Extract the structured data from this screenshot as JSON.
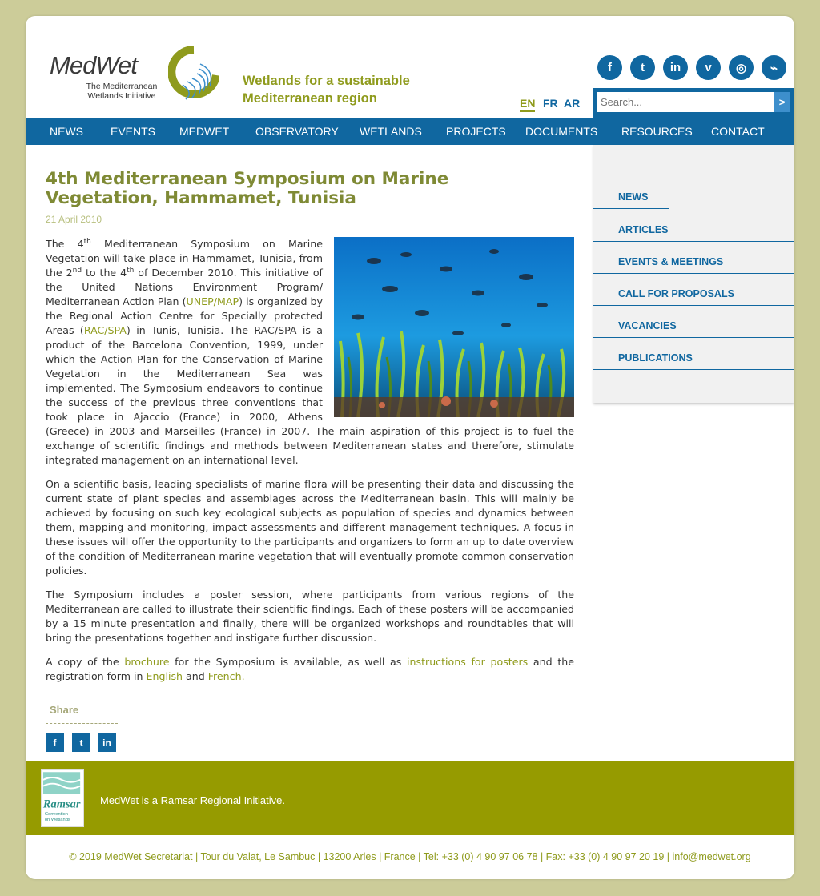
{
  "header": {
    "logo_word": "MedWet",
    "logo_sub": "The Mediterranean Wetlands Initiative",
    "tagline_line1": "Wetlands for a sustainable",
    "tagline_line2": "Mediterranean region",
    "social": [
      {
        "name": "facebook-icon",
        "glyph": "f"
      },
      {
        "name": "twitter-icon",
        "glyph": "t"
      },
      {
        "name": "linkedin-icon",
        "glyph": "in"
      },
      {
        "name": "vimeo-icon",
        "glyph": "v"
      },
      {
        "name": "instagram-icon",
        "glyph": "◎"
      },
      {
        "name": "rss-icon",
        "glyph": "⌁"
      }
    ],
    "languages": [
      "EN",
      "FR",
      "AR"
    ],
    "search_placeholder": "Search...",
    "search_button": ">"
  },
  "nav": [
    "NEWS",
    "EVENTS",
    "MEDWET",
    "OBSERVATORY",
    "WETLANDS",
    "PROJECTS",
    "DOCUMENTS",
    "RESOURCES",
    "CONTACT"
  ],
  "sidebar": [
    "NEWS",
    "ARTICLES",
    "EVENTS & MEETINGS",
    "CALL FOR PROPOSALS",
    "VACANCIES",
    "PUBLICATIONS"
  ],
  "article": {
    "title": "4th Mediterranean Symposium on Marine Vegetation, Hammamet, Tunisia",
    "date": "21 April 2010",
    "p1_a": "The 4",
    "p1_sup1": "th",
    "p1_b": " Mediterranean Symposium on Marine Vegetation will take place in Hammamet, Tunisia, from the 2",
    "p1_sup2": "nd",
    "p1_c": " to the 4",
    "p1_sup3": "th",
    "p1_d": " of December 2010. This initiative of the United Nations Environment Program/ Mediterranean Action Plan (",
    "p1_link1": "UNEP/MAP",
    "p1_e": ") is organized by the Regional Action Centre for Specially protected Areas (",
    "p1_link2": "RAC/SPA",
    "p1_f": ") in Tunis, Tunisia. The RAC/SPA is a product of the Barcelona Convention, 1999, under which the Action Plan for the Conservation of Marine Vegetation in the Mediterranean Sea was implemented. The Symposium endeavors to continue the success of the previous three conventions that took place in Ajaccio (France) in 2000,  Athens (Greece) in 2003 and Marseilles (France) in 2007. The main aspiration of this project is to fuel the exchange of scientific findings and methods between Mediterranean states and therefore, stimulate integrated management on an international level.",
    "p2": "On a scientific basis, leading specialists of marine flora will be presenting their data and discussing the current state of plant species and assemblages across the Mediterranean basin. This will mainly be achieved by focusing on such key ecological subjects as population of species and dynamics between them, mapping and monitoring, impact assessments and different management techniques. A focus in these issues will offer the opportunity to the participants and organizers to form an up to date overview of the condition of Mediterranean marine vegetation that will eventually promote common conservation policies.",
    "p3": "The Symposium includes a poster session, where participants from various regions of the Mediterranean are called to illustrate their scientific findings. Each of these posters will be accompanied by a 15 minute presentation and finally, there will be organized workshops and roundtables that will bring the presentations together and instigate further discussion.",
    "p4_a": "A copy of the ",
    "p4_link1": "brochure",
    "p4_b": " for the Symposium is available, as well as ",
    "p4_link2": "instructions for posters",
    "p4_c": " and the registration form in ",
    "p4_link3": "English",
    "p4_d": " and ",
    "p4_link4": "French."
  },
  "share": {
    "label": "Share",
    "buttons": [
      {
        "name": "share-facebook-icon",
        "glyph": "f"
      },
      {
        "name": "share-twitter-icon",
        "glyph": "t"
      },
      {
        "name": "share-linkedin-icon",
        "glyph": "in"
      }
    ]
  },
  "footer": {
    "ramsar_word": "Ramsar",
    "ramsar_sub": "Convention on Wetlands",
    "text": "MedWet is a Ramsar Regional Initiative.",
    "copyright": "© 2019 MedWet Secretariat | Tour du Valat, Le Sambuc | 13200 Arles | France | Tel: +33 (0) 4 90 97 06 78 | Fax: +33 (0) 4 90 97 20 19 | info@medwet.org"
  },
  "colors": {
    "background": "#cccc99",
    "brand_blue": "#1067a0",
    "olive": "#8f9b1d",
    "footer_green": "#969b00"
  }
}
